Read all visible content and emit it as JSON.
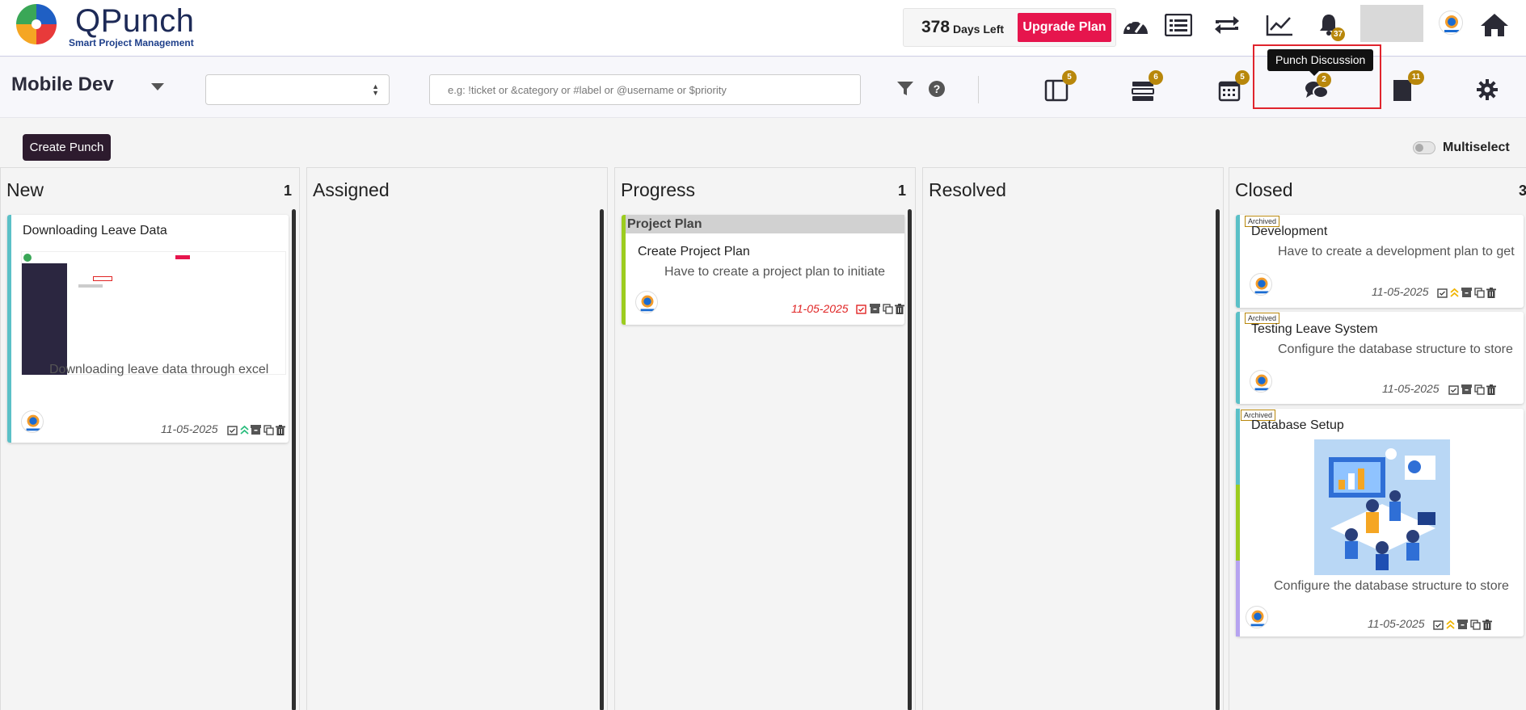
{
  "brand": {
    "name": "QPunch",
    "tagline": "Smart Project Management"
  },
  "plan": {
    "days_left_number": "378",
    "days_left_label": "Days Left",
    "upgrade_label": "Upgrade Plan"
  },
  "notifications": {
    "count": "37"
  },
  "project": {
    "title": "Mobile Dev"
  },
  "search": {
    "placeholder": "e.g: !ticket or &category or #label or @username or $priority"
  },
  "views": [
    {
      "name": "board-view",
      "badge": "5"
    },
    {
      "name": "list-view",
      "badge": "6"
    },
    {
      "name": "calendar-view",
      "badge": "5"
    },
    {
      "name": "punch-discussion",
      "badge": "2"
    },
    {
      "name": "notes-view",
      "badge": "11"
    }
  ],
  "tooltip": {
    "text": "Punch Discussion"
  },
  "toolbar": {
    "create_label": "Create Punch",
    "multiselect_label": "Multiselect"
  },
  "columns": [
    {
      "title": "New",
      "count": "1"
    },
    {
      "title": "Assigned",
      "count": ""
    },
    {
      "title": "Progress",
      "count": "1"
    },
    {
      "title": "Resolved",
      "count": ""
    },
    {
      "title": "Closed",
      "count": "3"
    }
  ],
  "cards": {
    "leave_data": {
      "title": "Downloading Leave Data",
      "bullet": "Downloading leave data through excel",
      "date": "11-05-2025"
    },
    "project_plan": {
      "group": "Project Plan",
      "title": "Create Project Plan",
      "bullet": "Have to create a project plan to initiate",
      "date": "11-05-2025"
    },
    "development": {
      "tag": "Archived",
      "title": "Development",
      "bullet": "Have to create a development plan to get",
      "date": "11-05-2025"
    },
    "testing_leave": {
      "tag": "Archived",
      "title": "Testing Leave System",
      "bullet": "Configure the database structure to store",
      "date": "11-05-2025"
    },
    "database_setup": {
      "tag": "Archived",
      "title": "Database Setup",
      "bullet": "Configure the database structure to store",
      "date": "11-05-2025"
    }
  },
  "colors": {
    "accent_red": "#e6154d",
    "badge_gold": "#b8870b",
    "dark_button": "#2d1b2e",
    "teal_strip": "#5bc0c7",
    "lime_strip": "#9ccc1f",
    "violet_strip": "#b6a3f0"
  }
}
